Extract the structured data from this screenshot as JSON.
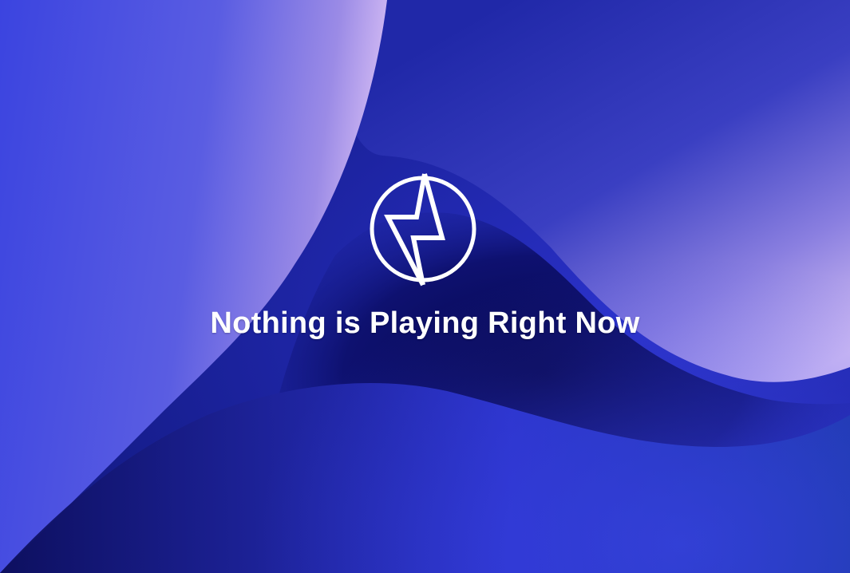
{
  "empty_state": {
    "message": "Nothing is Playing Right Now",
    "logo_icon": "lightning-bolt-circle-icon"
  },
  "colors": {
    "background_deep_blue": "#1b24a8",
    "shadow_navy": "#0a0a4a",
    "highlight_lavender": "#c9b0f0",
    "text": "#ffffff"
  }
}
